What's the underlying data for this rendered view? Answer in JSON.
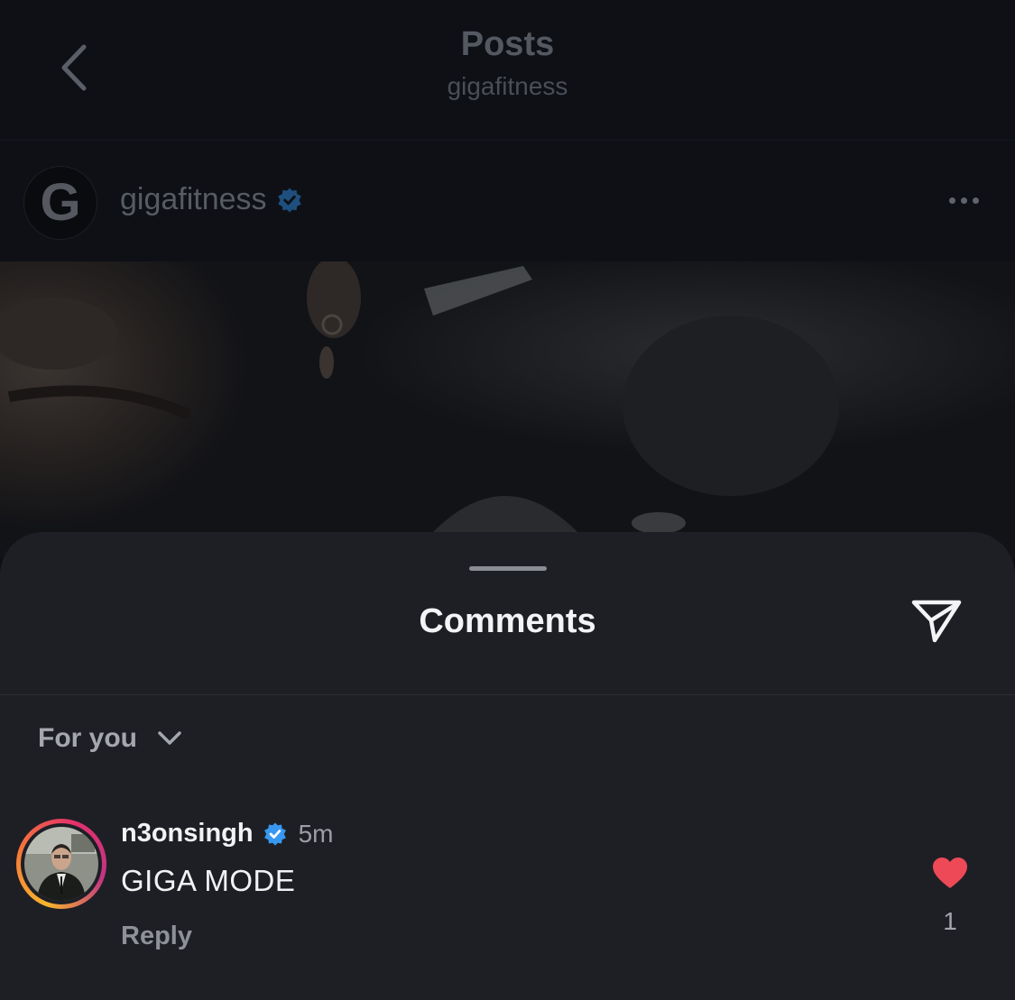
{
  "topbar": {
    "title": "Posts",
    "subtitle": "gigafitness",
    "back_icon": "chevron-left-icon"
  },
  "post": {
    "avatar_letter": "G",
    "username": "gigafitness",
    "verified": true,
    "more_icon": "more-horizontal-icon"
  },
  "comments_sheet": {
    "title": "Comments",
    "share_icon": "send-icon",
    "sort": {
      "label": "For you",
      "icon": "chevron-down-icon"
    },
    "comments": [
      {
        "username": "n3onsingh",
        "verified": true,
        "time": "5m",
        "text": "GIGA MODE",
        "reply_label": "Reply",
        "liked": true,
        "like_count": "1"
      }
    ]
  },
  "colors": {
    "verified_badge": "#3897f0",
    "like_heart": "#ed4956",
    "sheet_background": "#1e1f25",
    "page_background": "#0d0f14"
  }
}
